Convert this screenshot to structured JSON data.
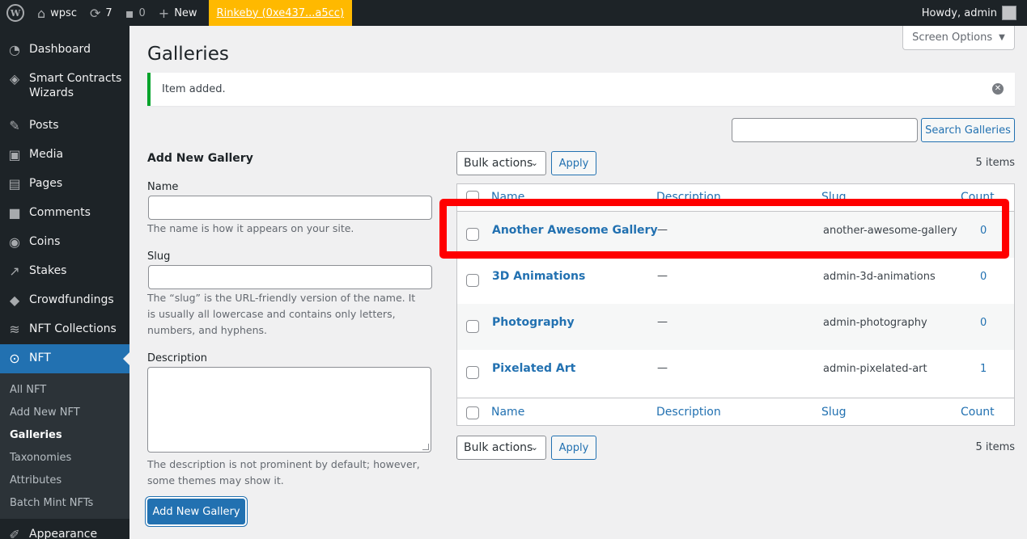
{
  "adminbar": {
    "site_name": "wpsc",
    "updates_count": "7",
    "comments_count": "0",
    "new_label": "New",
    "network_label": "Rinkeby (0xe437...a5cc)",
    "howdy": "Howdy, admin"
  },
  "sidebar": {
    "items": [
      {
        "label": "Dashboard",
        "icon": "dashboard-icon"
      },
      {
        "label": "Smart Contracts Wizards",
        "icon": "ethereum-icon"
      },
      {
        "label": "Posts",
        "icon": "pin-icon"
      },
      {
        "label": "Media",
        "icon": "media-icon"
      },
      {
        "label": "Pages",
        "icon": "pages-icon"
      },
      {
        "label": "Comments",
        "icon": "comments-icon"
      },
      {
        "label": "Coins",
        "icon": "coin-icon"
      },
      {
        "label": "Stakes",
        "icon": "chart-icon"
      },
      {
        "label": "Crowdfundings",
        "icon": "ethereum-icon"
      },
      {
        "label": "NFT Collections",
        "icon": "stack-icon"
      },
      {
        "label": "NFT",
        "icon": "nft-icon"
      }
    ],
    "submenu": [
      "All NFT",
      "Add New NFT",
      "Galleries",
      "Taxonomies",
      "Attributes",
      "Batch Mint NFTs"
    ],
    "appearance_label": "Appearance"
  },
  "main": {
    "screen_options": "Screen Options",
    "title": "Galleries",
    "notice": "Item added.",
    "search_button": "Search Galleries",
    "form": {
      "title": "Add New Gallery",
      "name_label": "Name",
      "name_help": "The name is how it appears on your site.",
      "slug_label": "Slug",
      "slug_help": "The “slug” is the URL-friendly version of the name. It is usually all lowercase and contains only letters, numbers, and hyphens.",
      "description_label": "Description",
      "description_help": "The description is not prominent by default; however, some themes may show it.",
      "submit": "Add New Gallery"
    },
    "bulk_actions": "Bulk actions",
    "apply": "Apply",
    "items_count": "5 items",
    "columns": {
      "name": "Name",
      "description": "Description",
      "slug": "Slug",
      "count": "Count"
    },
    "rows": [
      {
        "name": "Another Awesome Gallery",
        "description": "—",
        "slug": "another-awesome-gallery",
        "count": "0"
      },
      {
        "name": "3D Animations",
        "description": "—",
        "slug": "admin-3d-animations",
        "count": "0"
      },
      {
        "name": "Photography",
        "description": "—",
        "slug": "admin-photography",
        "count": "0"
      },
      {
        "name": "Pixelated Art",
        "description": "—",
        "slug": "admin-pixelated-art",
        "count": "1"
      }
    ]
  },
  "colors": {
    "accent": "#2271b1",
    "sidebar_bg": "#1d2327",
    "highlight": "#ff0000",
    "success": "#00a32a",
    "network_badge": "#ffb900"
  }
}
